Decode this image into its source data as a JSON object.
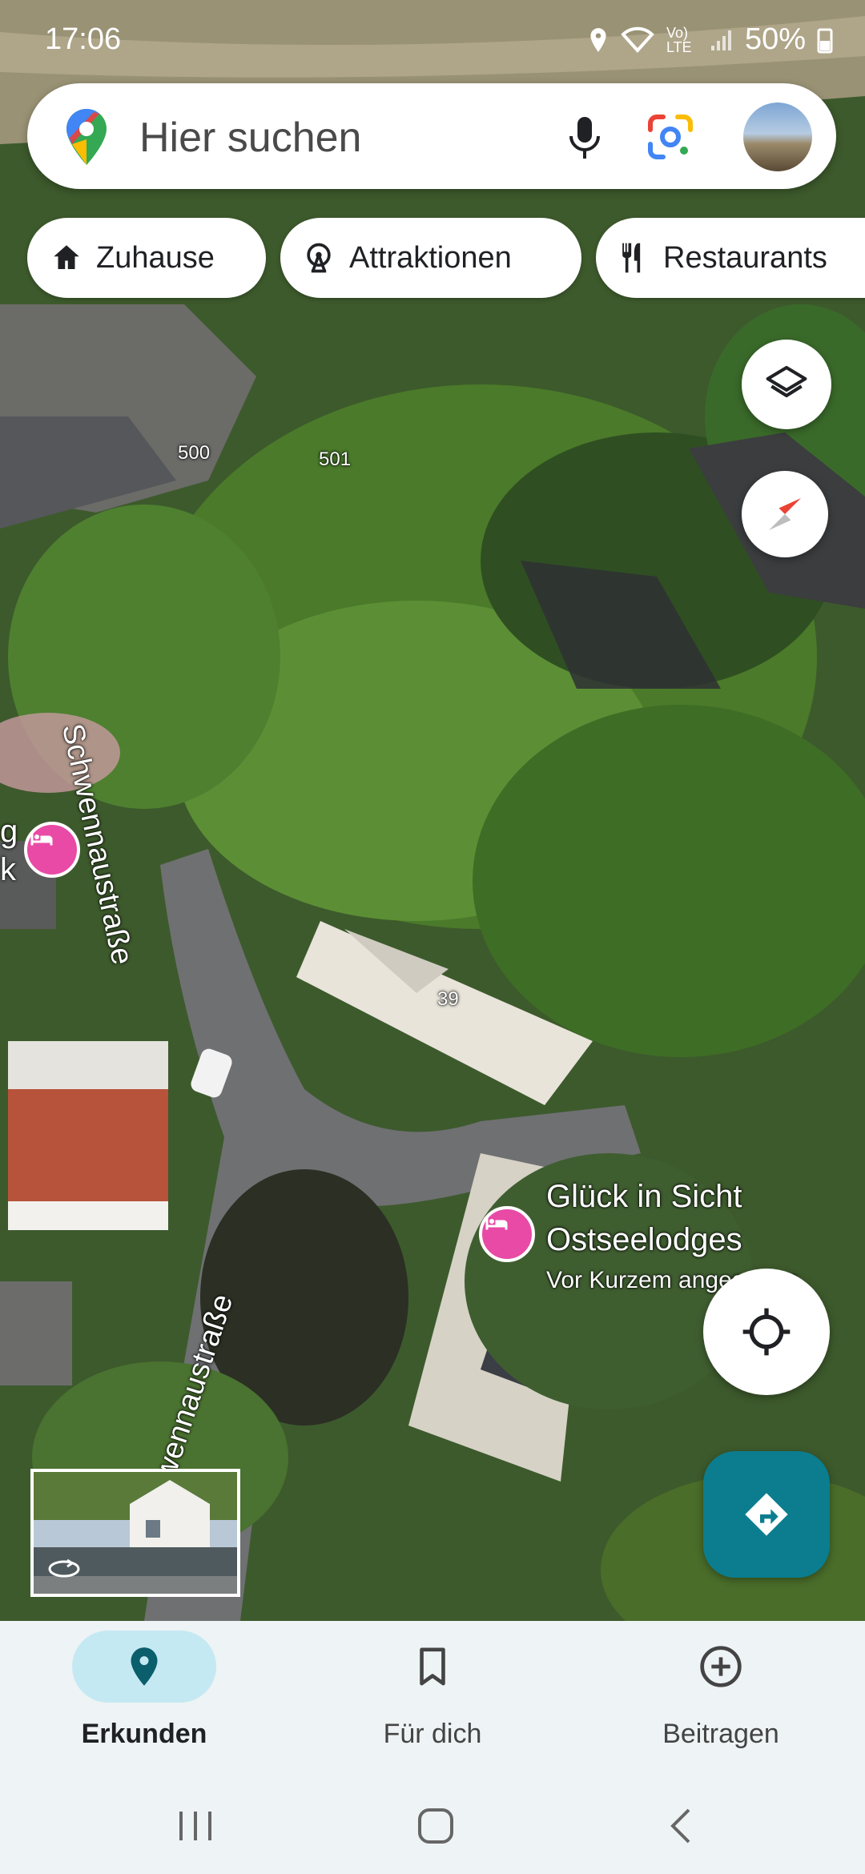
{
  "status_bar": {
    "time": "17:06",
    "battery": "50%",
    "network": "Vo) LTE"
  },
  "search": {
    "placeholder": "Hier suchen"
  },
  "chips": [
    {
      "label": "Zuhause",
      "icon": "home-icon"
    },
    {
      "label": "Attraktionen",
      "icon": "ferris-wheel-icon"
    },
    {
      "label": "Restaurants",
      "icon": "fork-knife-icon"
    }
  ],
  "map": {
    "street_names": [
      "Schwennaustraße",
      "wennaustraße"
    ],
    "house_numbers": [
      "500",
      "501",
      "39"
    ],
    "poi_main": {
      "name_line1": "Glück in Sicht",
      "name_line2": "Ostseelodges",
      "note": "Vor Kurzem angegeben"
    },
    "poi_left": {
      "partial_line1": "g",
      "partial_line2": "k"
    }
  },
  "bottom_nav": [
    {
      "label": "Erkunden",
      "icon": "location-pin-icon",
      "active": true
    },
    {
      "label": "Für dich",
      "icon": "bookmark-icon",
      "active": false
    },
    {
      "label": "Beitragen",
      "icon": "add-circle-icon",
      "active": false
    }
  ],
  "colors": {
    "accent": "#0b7d8f",
    "active_pill": "#c4e9f2",
    "poi": "#e84aa6"
  }
}
